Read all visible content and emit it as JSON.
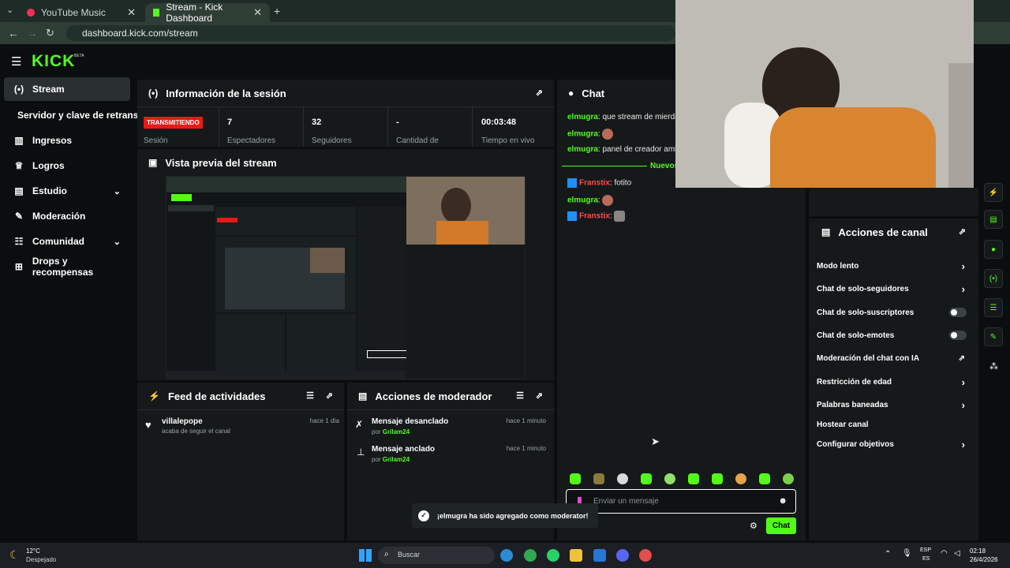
{
  "browser": {
    "tabs": [
      {
        "label": "YouTube Music"
      },
      {
        "label": "Stream - Kick Dashboard"
      }
    ],
    "url": "dashboard.kick.com/stream"
  },
  "brand": {
    "logo": "KICK",
    "badge": "BETA"
  },
  "sidebar": {
    "items": [
      {
        "label": "Stream",
        "icon": "broadcast-icon"
      },
      {
        "label": "Servidor y clave de retransn"
      },
      {
        "label": "Ingresos",
        "icon": "chart-icon"
      },
      {
        "label": "Logros",
        "icon": "trophy-icon"
      },
      {
        "label": "Estudio",
        "icon": "studio-icon"
      },
      {
        "label": "Moderación",
        "icon": "wrench-icon"
      },
      {
        "label": "Comunidad",
        "icon": "community-icon"
      },
      {
        "label": "Drops y recompensas",
        "icon": "drops-icon"
      }
    ]
  },
  "session": {
    "title": "Información de la sesión",
    "status": "TRANSMITIENDO",
    "status_label": "Sesión",
    "stats": [
      {
        "value": "7",
        "label": "Espectadores"
      },
      {
        "value": "32",
        "label": "Seguidores"
      },
      {
        "value": "-",
        "label": "Cantidad de suscripciones"
      },
      {
        "value": "00:03:48",
        "label": "Tiempo en vivo"
      }
    ]
  },
  "preview": {
    "title": "Vista previa del stream"
  },
  "feed": {
    "title": "Feed de actividades",
    "items": [
      {
        "user": "villalepope",
        "text": "acaba de seguir el canal",
        "time": "hace 1 día"
      }
    ]
  },
  "modactions": {
    "title": "Acciones de moderador",
    "items": [
      {
        "title": "Mensaje desanclado",
        "by_prefix": "por",
        "by": "Grilam24",
        "time": "hace 1 minuto"
      },
      {
        "title": "Mensaje anclado",
        "by_prefix": "por",
        "by": "Grilam24",
        "time": "hace 1 minuto"
      }
    ]
  },
  "chat": {
    "title": "Chat",
    "messages": [
      {
        "user": "elmugra",
        "text": ": que stream de mierda"
      },
      {
        "user": "elmugra",
        "text": ":"
      },
      {
        "user": "elmugra",
        "text": ": panel de creador amigo"
      },
      {
        "user": "Franstix",
        "text": ": fotito"
      },
      {
        "user": "elmugra",
        "text": ":"
      },
      {
        "user": "Franstix",
        "text": ":"
      }
    ],
    "new_divider": "Nuevos",
    "input_placeholder": "Enviar un mensaje",
    "send_label": "Chat"
  },
  "channel_actions": {
    "title": "Acciones de canal",
    "items": [
      {
        "label": "Modo lento",
        "control": "chevron"
      },
      {
        "label": "Chat de solo-seguidores",
        "control": "chevron"
      },
      {
        "label": "Chat de solo-suscriptores",
        "control": "toggle"
      },
      {
        "label": "Chat de solo-emotes",
        "control": "toggle"
      },
      {
        "label": "Moderación del chat con IA",
        "control": "external"
      },
      {
        "label": "Restricción de edad",
        "control": "chevron"
      },
      {
        "label": "Palabras baneadas",
        "control": "chevron"
      },
      {
        "label": "Hostear canal",
        "control": "none"
      },
      {
        "label": "Configurar objetivos",
        "control": "chevron"
      }
    ]
  },
  "toast": {
    "text": "¡elmugra ha sido agregado como moderator!"
  },
  "taskbar": {
    "weather_temp": "12°C",
    "weather_text": "Despejado",
    "search_placeholder": "Buscar",
    "lang_top": "ESP",
    "lang_bottom": "ES",
    "time": "02:18",
    "date": "26/4/2026"
  },
  "colors": {
    "accent": "#53fc18",
    "live": "#e91916",
    "panel": "#15191a",
    "bg": "#0b0e0f"
  }
}
